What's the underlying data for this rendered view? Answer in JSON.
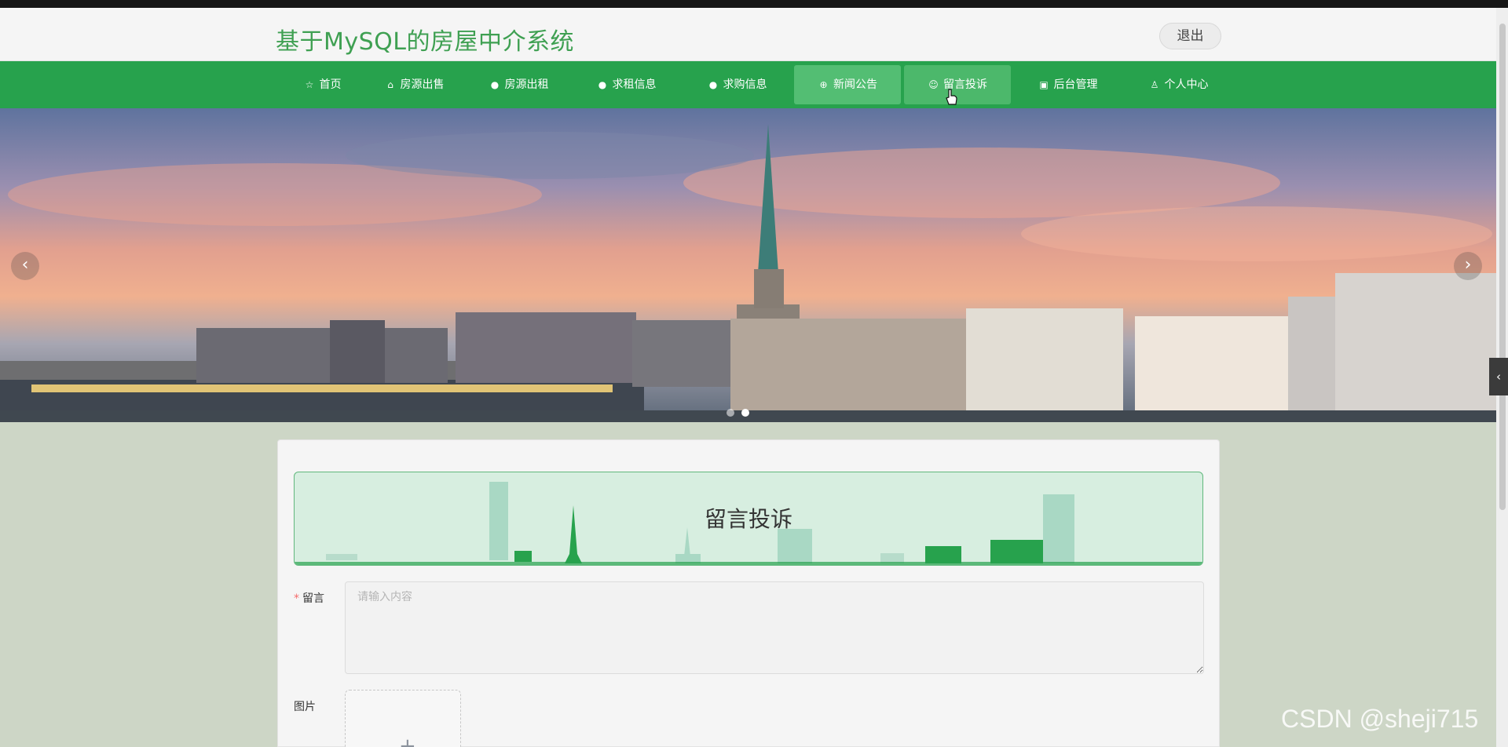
{
  "header": {
    "title": "基于MySQL的房屋中介系统",
    "logout_label": "退出"
  },
  "nav": {
    "items": [
      {
        "label": "首页",
        "icon": "star-icon",
        "glyph": "☆"
      },
      {
        "label": "房源出售",
        "icon": "bag-icon",
        "glyph": "⌂"
      },
      {
        "label": "房源出租",
        "icon": "info-icon",
        "glyph": "●"
      },
      {
        "label": "求租信息",
        "icon": "help-icon",
        "glyph": "●"
      },
      {
        "label": "求购信息",
        "icon": "info-icon",
        "glyph": "●"
      },
      {
        "label": "新闻公告",
        "icon": "globe-icon",
        "glyph": "⊕"
      },
      {
        "label": "留言投诉",
        "icon": "chat-icon",
        "glyph": "☺"
      },
      {
        "label": "后台管理",
        "icon": "clipboard-icon",
        "glyph": "▣"
      },
      {
        "label": "个人中心",
        "icon": "user-icon",
        "glyph": "♙"
      }
    ],
    "active_index": 5,
    "hover_index": 6
  },
  "banner": {
    "prev_glyph": "‹",
    "next_glyph": "›",
    "slide_count": 2,
    "current_slide": 2
  },
  "page": {
    "section_title": "留言投诉",
    "message_label": "留言",
    "message_placeholder": "请输入内容",
    "image_label": "图片",
    "upload_glyph": "+"
  },
  "side_tab_glyph": "‹",
  "watermark": "CSDN @sheji715",
  "colors": {
    "brand_green": "#27a24d",
    "title_green": "#3fa052",
    "active_nav": "#53be73",
    "required": "#f56c6c"
  }
}
